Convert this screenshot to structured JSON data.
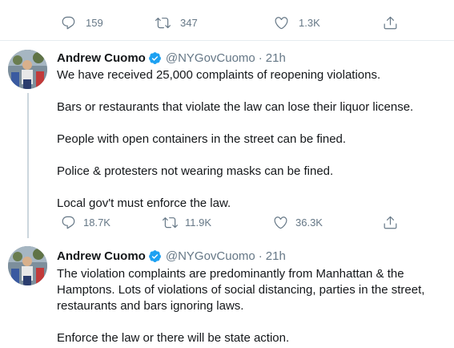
{
  "top_actions": {
    "reply_count": "159",
    "retweet_count": "347",
    "like_count": "1.3K"
  },
  "tweets": [
    {
      "display_name": "Andrew Cuomo",
      "handle": "@NYGovCuomo",
      "separator": "·",
      "time": "21h",
      "paragraphs": [
        "We have received 25,000 complaints of reopening violations.",
        "Bars or restaurants that violate the law can lose their liquor license.",
        "People with open containers in the street can be fined.",
        "Police & protesters not wearing masks can be fined.",
        "Local gov't must enforce the law."
      ],
      "reply_count": "18.7K",
      "retweet_count": "11.9K",
      "like_count": "36.3K"
    },
    {
      "display_name": "Andrew Cuomo",
      "handle": "@NYGovCuomo",
      "separator": "·",
      "time": "21h",
      "paragraphs": [
        "The violation complaints are predominantly from Manhattan & the Hamptons. Lots of violations of social distancing, parties in the street, restaurants and bars ignoring laws.",
        "Enforce the law or there will be state action."
      ]
    }
  ],
  "colors": {
    "verified": "#1da1f2",
    "muted": "#657786",
    "divider": "#e6ecf0",
    "thread": "#ccd6dd"
  },
  "icons": {
    "reply": "reply-icon",
    "retweet": "retweet-icon",
    "like": "like-icon",
    "share": "share-icon",
    "verified": "verified-badge-icon"
  }
}
